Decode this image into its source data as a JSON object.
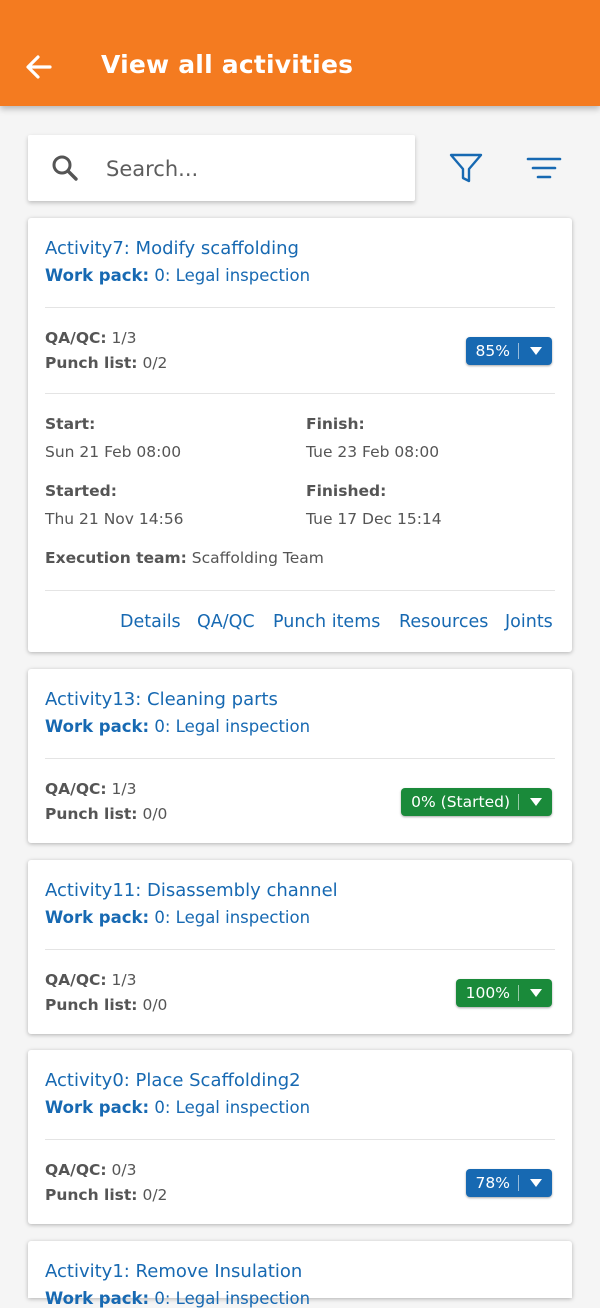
{
  "header": {
    "title": "View all activities",
    "back_icon": "arrow-left-icon",
    "background": "#f47b20"
  },
  "search": {
    "placeholder": "Search...",
    "value": "",
    "icon": "search-icon"
  },
  "toolbar": {
    "filter_icon": "filter-funnel-icon",
    "sort_icon": "sort-lines-icon"
  },
  "labels": {
    "work_pack": "Work pack:",
    "qaqc": "QA/QC:",
    "punch_list": "Punch list:",
    "start": "Start:",
    "finish": "Finish:",
    "started": "Started:",
    "finished": "Finished:",
    "execution_team": "Execution team:"
  },
  "colors": {
    "link": "#1769b2",
    "progress_blue": "#1769b2",
    "progress_green": "#1a8a3a"
  },
  "activities": [
    {
      "title": "Activity7: Modify scaffolding",
      "work_pack": "0: Legal inspection",
      "qaqc": "1/3",
      "punch_list": "0/2",
      "progress_label": "85%",
      "progress_color": "blue",
      "start": "Sun 21 Feb 08:00",
      "finish": "Tue 23 Feb 08:00",
      "started": "Thu 21 Nov 14:56",
      "finished": "Tue 17 Dec 15:14",
      "execution_team": "Scaffolding Team",
      "actions": [
        "Details",
        "QA/QC",
        "Punch items",
        "Resources",
        "Joints"
      ]
    },
    {
      "title": "Activity13: Cleaning parts",
      "work_pack": "0: Legal inspection",
      "qaqc": "1/3",
      "punch_list": "0/0",
      "progress_label": "0% (Started)",
      "progress_color": "green"
    },
    {
      "title": "Activity11: Disassembly channel",
      "work_pack": "0: Legal inspection",
      "qaqc": "1/3",
      "punch_list": "0/0",
      "progress_label": "100%",
      "progress_color": "green"
    },
    {
      "title": "Activity0: Place Scaffolding2",
      "work_pack": "0: Legal inspection",
      "qaqc": "0/3",
      "punch_list": "0/2",
      "progress_label": "78%",
      "progress_color": "blue"
    },
    {
      "title": "Activity1: Remove Insulation",
      "work_pack": "0: Legal inspection"
    }
  ]
}
